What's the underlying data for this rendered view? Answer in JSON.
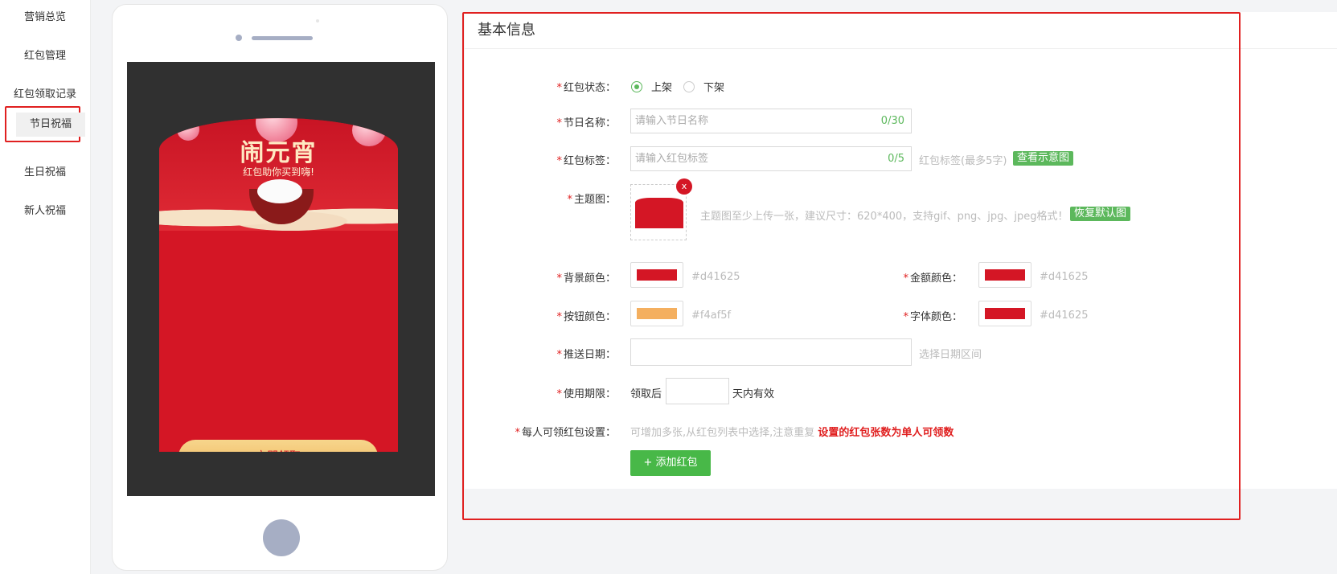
{
  "sidebar": {
    "items": [
      {
        "label": "营销总览"
      },
      {
        "label": "红包管理"
      },
      {
        "label": "红包领取记录"
      },
      {
        "label": "节日祝福"
      },
      {
        "label": "生日祝福"
      },
      {
        "label": "新人祝福"
      }
    ],
    "active_index": 3
  },
  "preview": {
    "banner_title": "闹元宵",
    "banner_subtitle": "红包助你买到嗨!",
    "button_label": "立即领取",
    "background_color": "#d41625",
    "button_color": "#f4af5f"
  },
  "form": {
    "title": "基本信息",
    "status": {
      "label": "红包状态：",
      "options": [
        "上架",
        "下架"
      ],
      "selected": "上架"
    },
    "festival_name": {
      "label": "节日名称：",
      "placeholder": "请输入节日名称",
      "counter": "0/30"
    },
    "tag": {
      "label": "红包标签：",
      "placeholder": "请输入红包标签",
      "counter": "0/5",
      "hint": "红包标签(最多5字)",
      "link": "查看示意图"
    },
    "theme_image": {
      "label": "主题图：",
      "remove_label": "x",
      "hint": "主题图至少上传一张，建议尺寸：620*400，支持gif、png、jpg、jpeg格式！",
      "restore": "恢复默认图"
    },
    "bg_color": {
      "label": "背景颜色：",
      "value": "#d41625"
    },
    "amount_color": {
      "label": "金额颜色：",
      "value": "#d41625"
    },
    "button_color": {
      "label": "按钮颜色：",
      "value": "#f4af5f"
    },
    "font_color": {
      "label": "字体颜色：",
      "value": "#d41625"
    },
    "push_date": {
      "label": "推送日期：",
      "hint": "选择日期区间"
    },
    "validity": {
      "label": "使用期限：",
      "prefix": "领取后",
      "suffix": "天内有效"
    },
    "per_person": {
      "label": "每人可领红包设置：",
      "hint": "可增加多张,从红包列表中选择,注意重复",
      "warn": "设置的红包张数为单人可领数"
    },
    "add_button": "+ 添加红包"
  }
}
